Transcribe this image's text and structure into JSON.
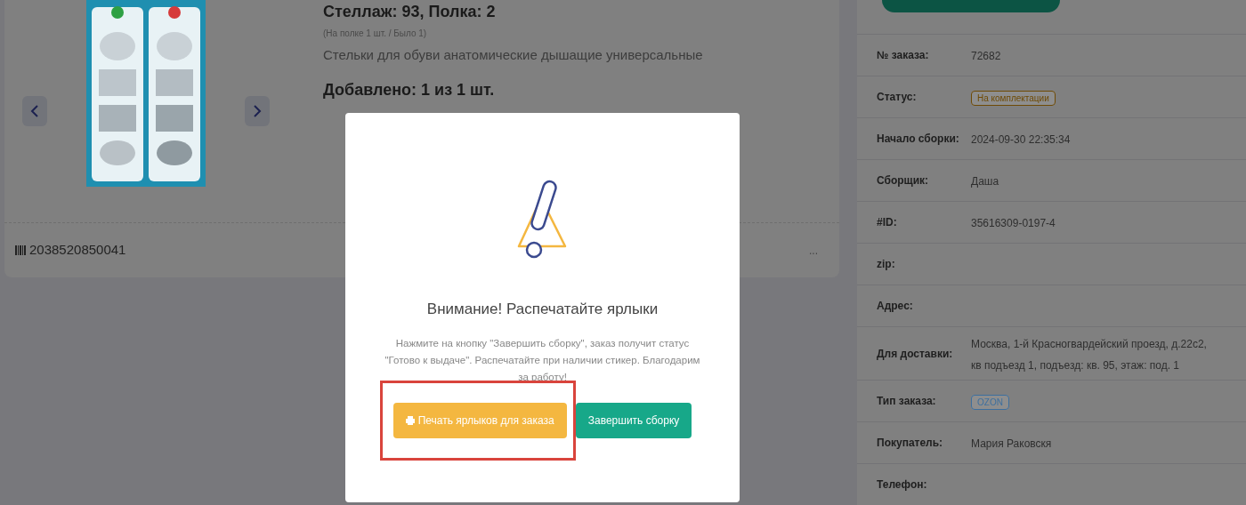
{
  "product": {
    "location": "Стеллаж: 93, Полка: 2",
    "stock_note": "(На полке 1 шт. / Было 1)",
    "name": "Стельки для обуви анатомические дышащие универсальные",
    "added": "Добавлено: 1 из 1 шт.",
    "barcode": "2038520850041",
    "more": "..."
  },
  "order_info": [
    {
      "label": "№ заказа:",
      "kind": "text",
      "value": "72682"
    },
    {
      "label": "Статус:",
      "kind": "badge",
      "value": "На комплектации",
      "color": "#6e4a05"
    },
    {
      "label": "Начало сборки:",
      "kind": "text",
      "value": "2024-09-30 22:35:34"
    },
    {
      "label": "Сборщик:",
      "kind": "text",
      "value": "Даша"
    },
    {
      "label": "#ID:",
      "kind": "text",
      "value": "35616309-0197-4"
    },
    {
      "label": "zip:"
    },
    {
      "label": "Адрес:"
    },
    {
      "label": "Для доставки:",
      "kind": "text",
      "value": "Москва, 1-й Красногвардейский проезд, д.22с2, кв подъезд 1, подъезд: кв. 95, этаж: под. 1"
    },
    {
      "label": "Тип заказа:",
      "kind": "badge",
      "value": "OZON",
      "color": "#3d6f9e"
    },
    {
      "label": "Покупатель:",
      "kind": "text",
      "value": "Мария Раковскя"
    },
    {
      "label": "Телефон:"
    }
  ],
  "modal": {
    "title": "Внимание! Распечатайте ярлыки",
    "message": "Нажмите на кнопку \"Завершить сборку\", заказ получит статус \"Готово к выдаче\". Распечатайте при наличии стикер. Благодарим за работу!",
    "buttons": [
      {
        "kind": "print",
        "label": "Печать ярлыков для заказа",
        "highlighted": true
      },
      {
        "kind": "finish",
        "label": "Завершить сборку",
        "highlighted": false
      }
    ]
  }
}
